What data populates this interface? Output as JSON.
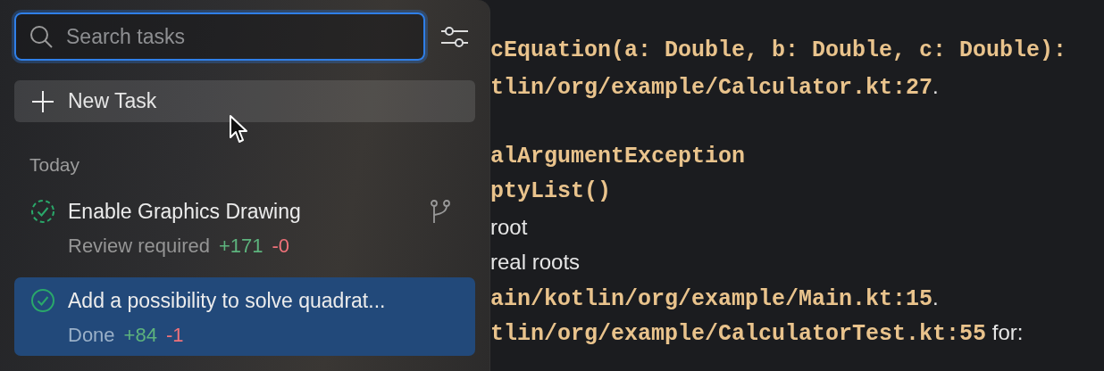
{
  "search": {
    "placeholder": "Search tasks"
  },
  "new_task": {
    "label": "New Task"
  },
  "section": "Today",
  "tasks": [
    {
      "title": "Enable Graphics Drawing",
      "status": "Review required",
      "kind": "review",
      "added": "+171",
      "removed": "-0",
      "branch": true,
      "selected": false
    },
    {
      "title": "Add a possibility to solve quadrat...",
      "status": "Done",
      "kind": "done",
      "added": "+84",
      "removed": "-1",
      "branch": false,
      "selected": true
    }
  ],
  "editor_lines": [
    {
      "kind": "line",
      "parts": [
        {
          "kind": "code",
          "text": "cEquation(a: Double, b: Double, c: Double):"
        }
      ]
    },
    {
      "kind": "line",
      "parts": [
        {
          "kind": "code",
          "text": "tlin/org/example/Calculator.kt:27"
        },
        {
          "kind": "text",
          "text": "."
        }
      ]
    },
    {
      "kind": "blank"
    },
    {
      "kind": "line",
      "parts": [
        {
          "kind": "code",
          "text": "alArgumentException"
        }
      ]
    },
    {
      "kind": "line",
      "parts": [
        {
          "kind": "code",
          "text": "ptyList()"
        }
      ]
    },
    {
      "kind": "line",
      "parts": [
        {
          "kind": "text",
          "text": "root"
        }
      ]
    },
    {
      "kind": "line",
      "parts": [
        {
          "kind": "text",
          "text": "real roots"
        }
      ]
    },
    {
      "kind": "line",
      "parts": [
        {
          "kind": "code",
          "text": "ain/kotlin/org/example/Main.kt:15"
        },
        {
          "kind": "text",
          "text": "."
        }
      ]
    },
    {
      "kind": "line",
      "parts": [
        {
          "kind": "code",
          "text": "tlin/org/example/CalculatorTest.kt:55"
        },
        {
          "kind": "text",
          "text": " for:"
        }
      ]
    }
  ]
}
